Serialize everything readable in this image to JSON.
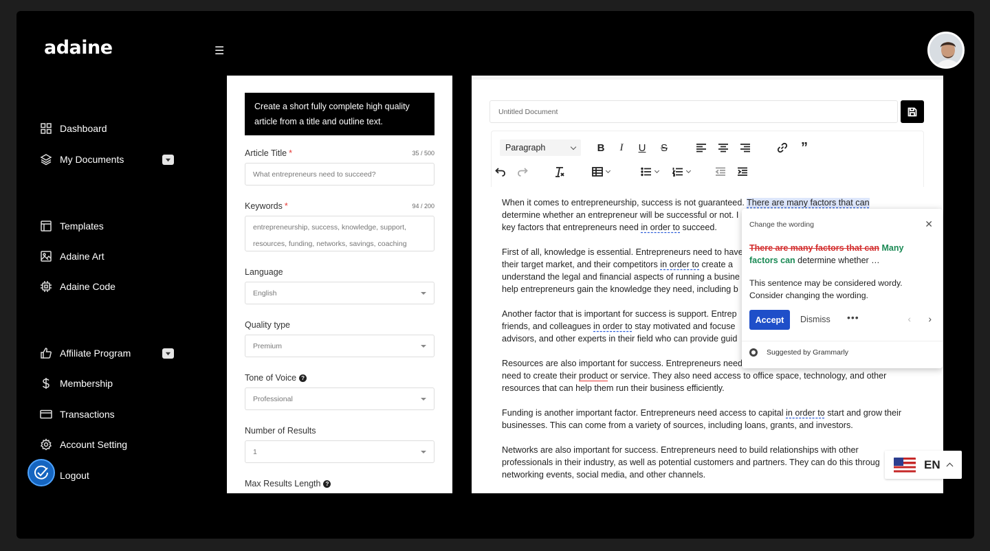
{
  "app": {
    "logo": "adaine"
  },
  "sidebar": {
    "groups": [
      [
        {
          "label": "Dashboard",
          "icon": "dashboard-icon"
        },
        {
          "label": "My Documents",
          "icon": "layers-icon",
          "expandable": true
        }
      ],
      [
        {
          "label": "Templates",
          "icon": "template-icon"
        },
        {
          "label": "Adaine Art",
          "icon": "image-icon"
        },
        {
          "label": "Adaine Code",
          "icon": "chip-icon"
        }
      ],
      [
        {
          "label": "Affiliate Program",
          "icon": "thumbs-up-icon",
          "expandable": true
        },
        {
          "label": "Membership",
          "icon": "dollar-icon"
        },
        {
          "label": "Transactions",
          "icon": "credit-card-icon"
        },
        {
          "label": "Account Setting",
          "icon": "gear-icon"
        },
        {
          "label": "Logout",
          "icon": "logout-icon"
        }
      ]
    ]
  },
  "form": {
    "hint": "Create a short fully complete high quality article from a title and outline text.",
    "article_title": {
      "label": "Article Title",
      "required_mark": "*",
      "counter": "35 / 500",
      "placeholder": "What entrepreneurs need to succeed?"
    },
    "keywords": {
      "label": "Keywords",
      "required_mark": "*",
      "counter": "94 / 200",
      "line1": "entrepreneurship, success, knowledge, support,",
      "line2": "resources, funding, networks, savings, coaching"
    },
    "language": {
      "label": "Language",
      "value": "English"
    },
    "quality": {
      "label": "Quality type",
      "value": "Premium"
    },
    "tone": {
      "label": "Tone of Voice",
      "help": "?",
      "value": "Professional"
    },
    "results": {
      "label": "Number of Results",
      "value": "1"
    },
    "max_length": {
      "label": "Max Results Length",
      "help": "?"
    }
  },
  "editor": {
    "doc_title_placeholder": "Untitled Document",
    "paragraph_style": "Paragraph",
    "quote_glyph": "”",
    "paragraphs": [
      {
        "l1a": "When it comes to entrepreneurship, success is not guaranteed. ",
        "l1b": "There are many factors that can",
        "l2": "determine whether an entrepreneur will be successful or not. I",
        "l3a": "key factors that entrepreneurs need ",
        "l3b": "in order to",
        "l3c": " succeed."
      },
      {
        "l1": "First of all, knowledge is essential. Entrepreneurs need to have",
        "l2a": "their target market, and their competitors ",
        "l2b": "in order to",
        "l2c": " create a",
        "l3": "understand the legal and financial aspects of running a busine",
        "l4": "help entrepreneurs gain the knowledge they need, including b"
      },
      {
        "l1": "Another factor that is important for success is support. Entrep",
        "l2a": "friends, and colleagues ",
        "l2b": "in order to",
        "l2c": " stay motivated and focuse",
        "l3": "advisors, and other experts in their field who can provide guid"
      },
      {
        "l1": "Resources are also important for success. Entrepreneurs need",
        "l2a": "need to create their ",
        "l2b": "product",
        "l2c": " or service. They also need access to office space, technology, and other",
        "l3": "resources that can help them run their business efficiently."
      },
      {
        "l1a": "Funding is another important factor. Entrepreneurs need access to capital ",
        "l1b": "in order to",
        "l1c": " start and grow their",
        "l2": "businesses. This can come from a variety of sources, including loans, grants, and investors."
      },
      {
        "l1": "Networks are also important for success. Entrepreneurs need to build relationships with other",
        "l2": "professionals in their industry, as well as potential customers and partners. They can do this throug",
        "l3": "networking events, social media, and other channels."
      }
    ]
  },
  "grammarly": {
    "title": "Change the wording",
    "strike": "There are many factors that can",
    "insert_a": "Many",
    "insert_b": "factors can",
    "rest": " determine whether …",
    "explanation_l1": "This sentence may be considered wordy.",
    "explanation_l2": "Consider changing the wording.",
    "accept": "Accept",
    "dismiss": "Dismiss",
    "more": "•••",
    "prev": "‹",
    "next": "›",
    "footer": "Suggested by Grammarly",
    "close": "✕"
  },
  "language_widget": {
    "code": "EN"
  },
  "colors": {
    "accent": "#1f4fc9",
    "strike": "#d32f2f",
    "insert": "#1b8a55"
  }
}
